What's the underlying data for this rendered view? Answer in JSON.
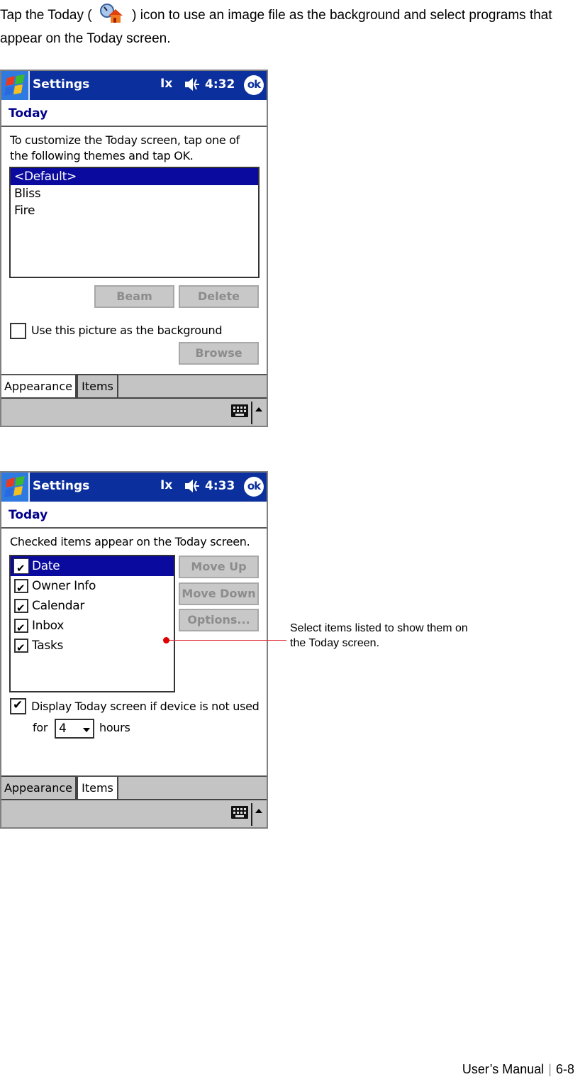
{
  "intro": {
    "text_before_icon": "Tap the Today ( ",
    "icon": "today-settings-icon",
    "text_after_icon": " ) icon to use an image file as the background and select programs that appear on the Today screen."
  },
  "screens": [
    {
      "titlebar": {
        "title": "Settings",
        "signal": "Ix",
        "clock": "4:32",
        "ok_label": "ok"
      },
      "heading": "Today",
      "instruction_line1": "To customize the Today screen, tap one of",
      "instruction_line2": "the following themes and tap OK.",
      "themes": [
        {
          "label": "<Default>",
          "selected": true
        },
        {
          "label": "Bliss",
          "selected": false
        },
        {
          "label": "Fire",
          "selected": false
        }
      ],
      "buttons": {
        "beam": "Beam",
        "delete": "Delete",
        "browse": "Browse"
      },
      "background_checkbox": {
        "label": "Use this picture as the background",
        "checked": false
      },
      "tabs": [
        {
          "label": "Appearance",
          "active": true
        },
        {
          "label": "Items",
          "active": false
        }
      ]
    },
    {
      "titlebar": {
        "title": "Settings",
        "signal": "Ix",
        "clock": "4:33",
        "ok_label": "ok"
      },
      "heading": "Today",
      "instruction": "Checked items appear on the Today screen.",
      "items": [
        {
          "label": "Date",
          "checked": true,
          "selected": true
        },
        {
          "label": "Owner Info",
          "checked": true,
          "selected": false
        },
        {
          "label": "Calendar",
          "checked": true,
          "selected": false
        },
        {
          "label": "Inbox",
          "checked": true,
          "selected": false
        },
        {
          "label": "Tasks",
          "checked": true,
          "selected": false
        }
      ],
      "buttons": {
        "move_up": "Move Up",
        "move_down": "Move Down",
        "options": "Options..."
      },
      "display_checkbox": {
        "label": "Display Today screen if device is not used",
        "checked": true
      },
      "for_label": "for",
      "hours_value": "4",
      "hours_label": "hours",
      "tabs": [
        {
          "label": "Appearance",
          "active": false
        },
        {
          "label": "Items",
          "active": true
        }
      ]
    }
  ],
  "callout": {
    "line1": "Select items listed to show them on",
    "line2": "the Today screen."
  },
  "footer": {
    "manual": "User’s Manual",
    "separator": "|",
    "page": "6-8"
  },
  "colors": {
    "titlebar": "#0b2f9c",
    "selection": "#0a0a9e",
    "heading": "#00008b",
    "callout": "#e00000"
  }
}
